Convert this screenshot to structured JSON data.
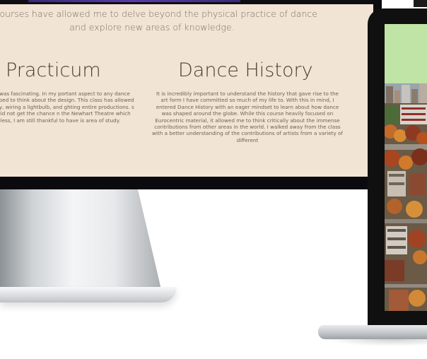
{
  "monitor_page": {
    "intro": "e courses have allowed me to delve beyond the physical practice of dance and explore new areas of knowledge.",
    "left_section": {
      "title": "Practicum",
      "body": "o course was fascinating. In my portant aspect to any dance never stopped to think about the design. This class has allowed me ectricity, wiring a lightbulb, and ghting entire productions. s online, I did not get the chance n the Newhart Theatre which was eless, I am still thankful to have is area of study."
    },
    "right_section": {
      "title": "Dance History",
      "body": "It is incredibly important to understand the history that gave rise to the art form I have committed so much of my life to. With this in mind, I entered Dance History with an eager mindset to learn about how dance was shaped around the globe. While this course heavily focused on Eurocentric material, it allowed me to think critically about the immense contributions from other areas in the world. I walked away from the class with a better understanding of the contributions of artists from a variety of different"
    }
  },
  "colors": {
    "page_background": "#f2e4d4",
    "laptop_header": "#bfe4a6",
    "heading_text": "#4a3f36",
    "body_text": "#6e6157"
  }
}
